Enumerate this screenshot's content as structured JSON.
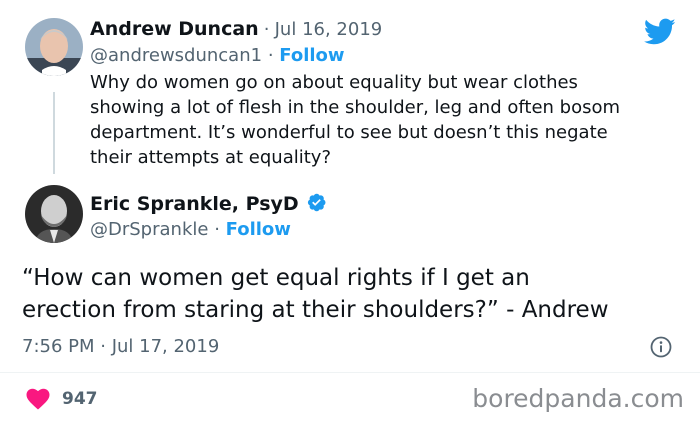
{
  "reply_tweet": {
    "author_name": "Andrew Duncan",
    "date_sep": "·",
    "date": "Jul 16, 2019",
    "handle": "@andrewsduncan1",
    "handle_sep": "·",
    "follow_label": "Follow",
    "text_lines": [
      "Why do women go on about equality but wear clothes",
      "showing a lot of flesh in the shoulder, leg and often bosom",
      "department. It’s wonderful to see but doesn’t this negate",
      "their attempts at equality?"
    ]
  },
  "main_tweet": {
    "author_name": "Eric Sprankle, PsyD",
    "handle": "@DrSprankle",
    "handle_sep": "·",
    "follow_label": "Follow",
    "text_lines": [
      "“How can women get equal rights if I get an",
      "erection from staring at their shoulders?” - Andrew"
    ],
    "timestamp": "7:56 PM · Jul 17, 2019"
  },
  "engagement": {
    "likes": "947"
  },
  "watermark": "boredpanda.com",
  "colors": {
    "twitter_blue": "#1d9bf0",
    "like_red": "#f91880",
    "text_primary": "#0f1419",
    "text_secondary": "#536471"
  },
  "icons": {
    "brand": "twitter-bird-icon",
    "verified": "verified-badge-icon",
    "info": "info-icon",
    "like": "heart-icon"
  }
}
